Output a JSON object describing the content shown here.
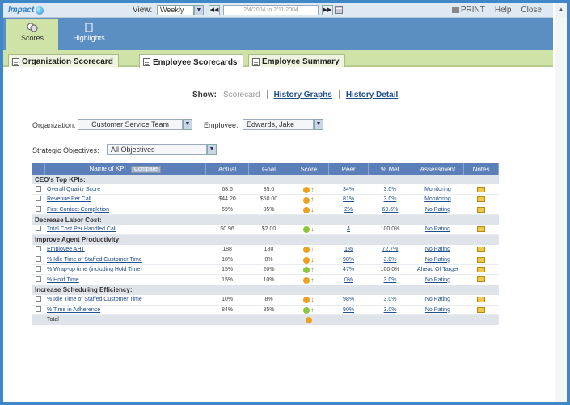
{
  "app": {
    "title": "Impact"
  },
  "topbar": {
    "view_label": "View:",
    "view_value": "Weekly",
    "date_range": "2/4/2004 to 2/11/2004",
    "print": "PRINT",
    "help": "Help",
    "close": "Close"
  },
  "modules": [
    {
      "label": "Scores",
      "icon": "scores-icon",
      "active": true
    },
    {
      "label": "Highlights",
      "icon": "highlights-icon",
      "active": false
    }
  ],
  "subtabs": [
    {
      "label": "Organization Scorecard",
      "active": false
    },
    {
      "label": "Employee Scorecards",
      "active": true
    },
    {
      "label": "Employee Summary",
      "active": false
    }
  ],
  "show": {
    "label": "Show:",
    "current": "Scorecard",
    "links": [
      "History Graphs",
      "History Detail"
    ]
  },
  "filters": {
    "organization_label": "Organization:",
    "organization_value": "Customer Service Team",
    "employee_label": "Employee:",
    "employee_value": "Edwards, Jake",
    "objectives_label": "Strategic Objectives:",
    "objectives_value": "All Objectives"
  },
  "table": {
    "columns": [
      "Name of KPI",
      "Actual",
      "Goal",
      "Score",
      "Peer",
      "% Met",
      "Assessment",
      "Notes"
    ],
    "compare_label": "Compare",
    "groups": [
      {
        "title": "CEO's Top KPIs:",
        "rows": [
          {
            "name": "Overall Quality Score",
            "actual": "68.6",
            "goal": "85.0",
            "face": "orange",
            "trend": "up",
            "peer": "34%",
            "met": "3.0%",
            "assessment": "Monitoring"
          },
          {
            "name": "Revenue Per Call",
            "actual": "$44.20",
            "goal": "$50.00",
            "face": "orange",
            "trend": "up",
            "peer": "81%",
            "met": "3.0%",
            "assessment": "Monitoring"
          },
          {
            "name": "First Contact Completion",
            "actual": "69%",
            "goal": "85%",
            "face": "orange",
            "trend": "down",
            "peer": "2%",
            "met": "60.6%",
            "assessment": "No Rating"
          }
        ]
      },
      {
        "title": "Decrease Labor Cost:",
        "rows": [
          {
            "name": "Total Cost Per Handled Call",
            "actual": "$0.96",
            "goal": "$2.00",
            "face": "green",
            "trend": "down",
            "peer": "4",
            "met": "100.0%",
            "assessment": "No Rating"
          }
        ]
      },
      {
        "title": "Improve Agent Productivity:",
        "rows": [
          {
            "name": "Employee AHT",
            "actual": "188",
            "goal": "180",
            "face": "orange",
            "trend": "down",
            "peer": "1%",
            "met": "72.7%",
            "assessment": "No Rating"
          },
          {
            "name": "% Idle Time of Staffed Customer Time",
            "actual": "10%",
            "goal": "8%",
            "face": "orange",
            "trend": "down",
            "peer": "98%",
            "met": "3.0%",
            "assessment": "No Rating"
          },
          {
            "name": "% Wrap-up time (including Hold Time)",
            "actual": "15%",
            "goal": "20%",
            "face": "green",
            "trend": "up",
            "peer": "47%",
            "met": "100.0%",
            "assessment": "Ahead Of Target"
          },
          {
            "name": "% Hold Time",
            "actual": "15%",
            "goal": "10%",
            "face": "orange",
            "trend": "up",
            "peer": "0%",
            "met": "3.0%",
            "assessment": "No Rating"
          }
        ]
      },
      {
        "title": "Increase Scheduling Efficiency:",
        "rows": [
          {
            "name": "% Idle Time of Staffed Customer Time",
            "actual": "10%",
            "goal": "8%",
            "face": "orange",
            "trend": "down",
            "peer": "98%",
            "met": "3.0%",
            "assessment": "No Rating"
          },
          {
            "name": "% Time in Adherence",
            "actual": "84%",
            "goal": "85%",
            "face": "green",
            "trend": "up",
            "peer": "90%",
            "met": "3.0%",
            "assessment": "No Rating"
          }
        ]
      }
    ],
    "total_label": "Total",
    "total_face": "orange"
  },
  "colors": {
    "face_orange": "#f0a020",
    "face_green": "#8cc63f",
    "header_blue": "#5b7fb8"
  }
}
